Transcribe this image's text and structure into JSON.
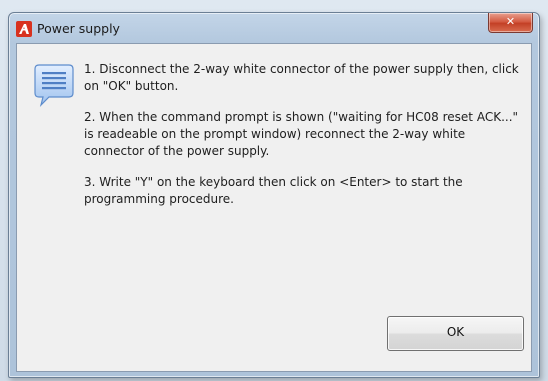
{
  "window": {
    "title": "Power supply",
    "close_glyph": "✕",
    "icon": "app-logo-icon",
    "accent_color": "#c23e24"
  },
  "message": {
    "icon": "speech-bubble-icon",
    "paragraphs": [
      "1. Disconnect the 2-way white connector of the power supply then, click on \"OK\" button.",
      "2. When the command prompt is shown (\"waiting for HC08 reset ACK...\" is readeable on the prompt window) reconnect the 2-way white connector of the power supply.",
      "3. Write \"Y\" on the keyboard then click on <Enter> to start the programming procedure."
    ]
  },
  "buttons": {
    "ok_label": "OK"
  }
}
